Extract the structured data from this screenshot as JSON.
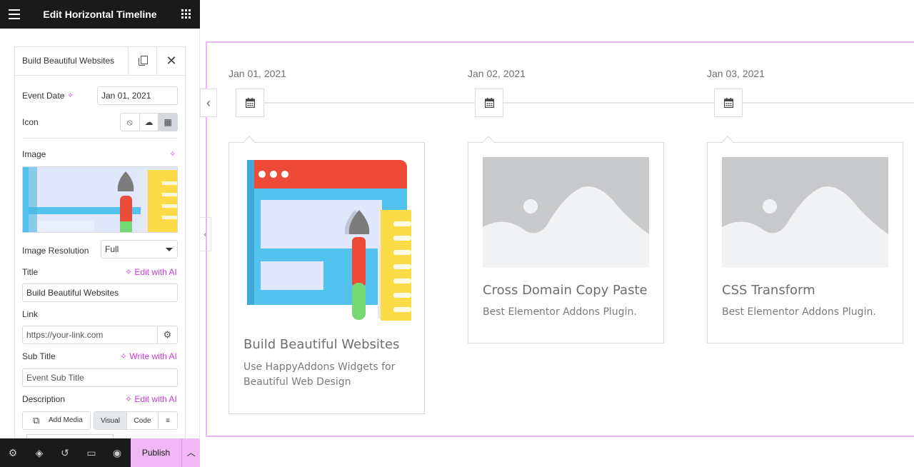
{
  "panel": {
    "title": "Edit Horizontal Timeline",
    "item_label": "Build Beautiful Websites",
    "event_date_label": "Event Date",
    "event_date_value": "Jan 01, 2021",
    "icon_label": "Icon",
    "image_label": "Image",
    "image_resolution_label": "Image Resolution",
    "image_resolution_value": "Full",
    "title_label": "Title",
    "title_ai": "Edit with AI",
    "title_value": "Build Beautiful Websites",
    "link_label": "Link",
    "link_placeholder": "https://your-link.com",
    "subtitle_label": "Sub Title",
    "subtitle_ai": "Write with AI",
    "subtitle_placeholder": "Event Sub Title",
    "description_label": "Description",
    "description_ai": "Edit with AI",
    "add_media": "Add Media",
    "tab_visual": "Visual",
    "tab_code": "Code"
  },
  "footer": {
    "publish_label": "Publish"
  },
  "timeline": {
    "events": [
      {
        "date": "Jan 01, 2021",
        "title": "Build Beautiful Websites",
        "description_line1": "Use HappyAddons Widgets for",
        "description_line2": "Beautiful Web Design"
      },
      {
        "date": "Jan 02, 2021",
        "title": "Cross Domain Copy Paste",
        "description_line1": "Best Elementor Addons Plugin.",
        "description_line2": ""
      },
      {
        "date": "Jan 03, 2021",
        "title": "CSS Transform",
        "description_line1": "Best Elementor Addons Plugin.",
        "description_line2": ""
      }
    ]
  },
  "colors": {
    "accent": "#c93bd6",
    "publish_bg": "#f0b8f5",
    "panel_header_bg": "#1a1a1a",
    "section_border": "#e7b7f0"
  }
}
